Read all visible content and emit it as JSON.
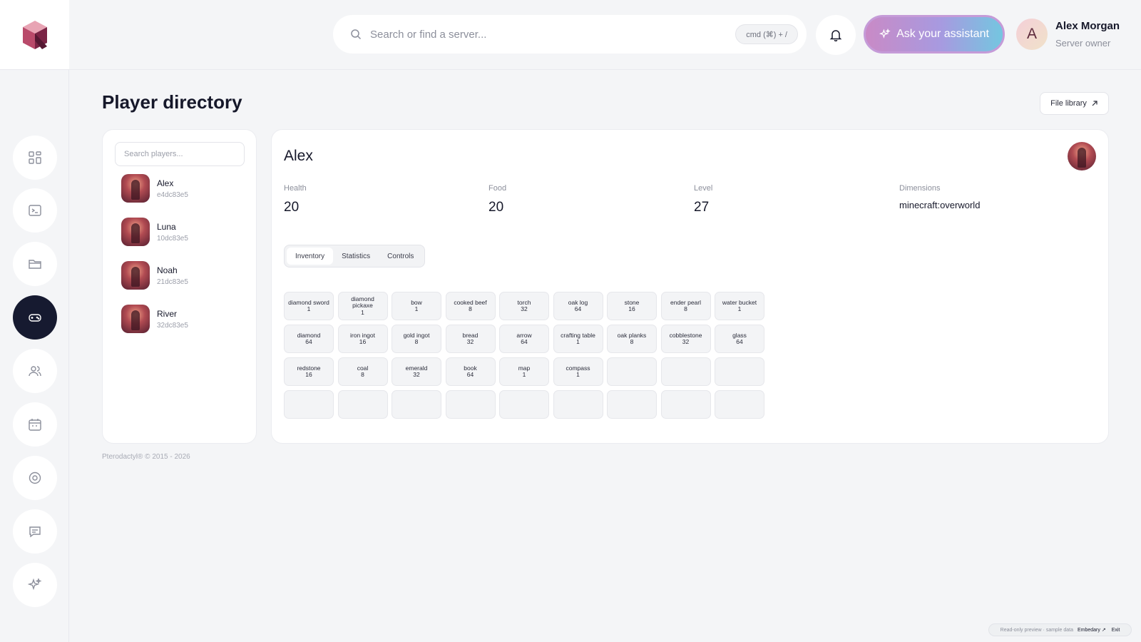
{
  "header": {
    "search_placeholder": "Search or find a server...",
    "shortcut": "cmd (⌘) + /",
    "assistant_label": "Ask your assistant",
    "user": {
      "initial": "A",
      "name": "Alex Morgan",
      "role": "Server owner"
    }
  },
  "sidebar": {
    "items": [
      {
        "icon": "dashboard-icon",
        "active": false
      },
      {
        "icon": "terminal-icon",
        "active": false
      },
      {
        "icon": "folder-icon",
        "active": false
      },
      {
        "icon": "gamepad-icon",
        "active": true
      },
      {
        "icon": "users-icon",
        "active": false
      },
      {
        "icon": "calendar-icon",
        "active": false
      },
      {
        "icon": "settings-icon",
        "active": false
      },
      {
        "icon": "chat-icon",
        "active": false
      },
      {
        "icon": "sparkle-icon",
        "active": false
      }
    ]
  },
  "page": {
    "title": "Player directory",
    "file_library": "File library"
  },
  "players": {
    "search_placeholder": "Search players...",
    "list": [
      {
        "name": "Alex",
        "id": "e4dc83e5"
      },
      {
        "name": "Luna",
        "id": "10dc83e5"
      },
      {
        "name": "Noah",
        "id": "21dc83e5"
      },
      {
        "name": "River",
        "id": "32dc83e5"
      }
    ]
  },
  "detail": {
    "name": "Alex",
    "stats": [
      {
        "label": "Health",
        "value": "20"
      },
      {
        "label": "Food",
        "value": "20"
      },
      {
        "label": "Level",
        "value": "27"
      },
      {
        "label": "Dimensions",
        "value": "minecraft:overworld"
      }
    ],
    "tabs": [
      "Inventory",
      "Statistics",
      "Controls"
    ],
    "active_tab": "Inventory",
    "inventory": [
      {
        "name": "diamond sword",
        "count": "1"
      },
      {
        "name": "diamond pickaxe",
        "count": "1"
      },
      {
        "name": "bow",
        "count": "1"
      },
      {
        "name": "cooked beef",
        "count": "8"
      },
      {
        "name": "torch",
        "count": "32"
      },
      {
        "name": "oak log",
        "count": "64"
      },
      {
        "name": "stone",
        "count": "16"
      },
      {
        "name": "ender pearl",
        "count": "8"
      },
      {
        "name": "water bucket",
        "count": "1"
      },
      {
        "name": "diamond",
        "count": "64"
      },
      {
        "name": "iron ingot",
        "count": "16"
      },
      {
        "name": "gold ingot",
        "count": "8"
      },
      {
        "name": "bread",
        "count": "32"
      },
      {
        "name": "arrow",
        "count": "64"
      },
      {
        "name": "crafting table",
        "count": "1"
      },
      {
        "name": "oak planks",
        "count": "8"
      },
      {
        "name": "cobblestone",
        "count": "32"
      },
      {
        "name": "glass",
        "count": "64"
      },
      {
        "name": "redstone",
        "count": "16"
      },
      {
        "name": "coal",
        "count": "8"
      },
      {
        "name": "emerald",
        "count": "32"
      },
      {
        "name": "book",
        "count": "64"
      },
      {
        "name": "map",
        "count": "1"
      },
      {
        "name": "compass",
        "count": "1"
      }
    ],
    "total_slots": 36
  },
  "footer": "Pterodactyl® © 2015 - 2026",
  "preview": {
    "text": "Read-only preview · sample data",
    "link": "Embedary ↗",
    "exit": "Exit"
  }
}
